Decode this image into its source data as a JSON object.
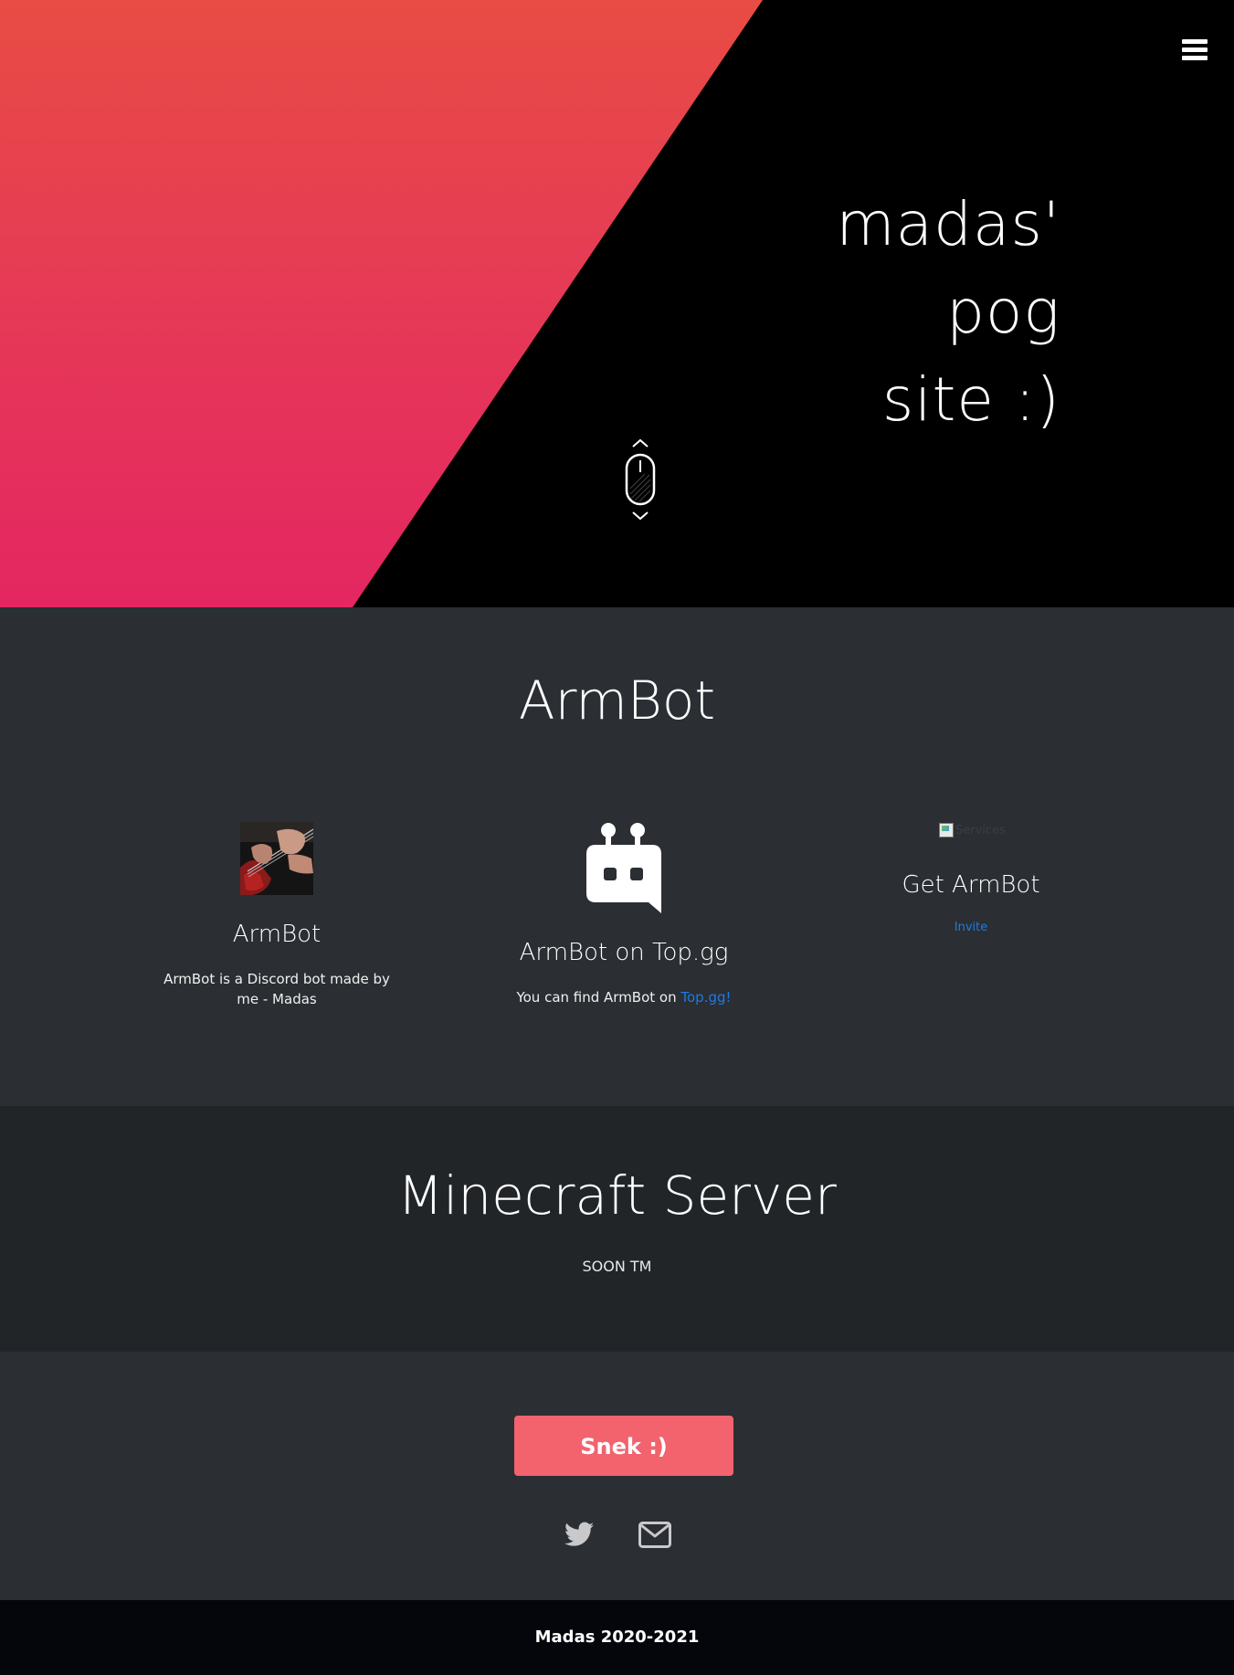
{
  "hero": {
    "title_lines": [
      "madas'",
      "pog",
      "site :)"
    ],
    "menu_icon": "hamburger-menu-icon",
    "scroll_icon": "mouse-scroll-icon",
    "gradient_colors": [
      "#e84c44",
      "#e42661"
    ],
    "background": "#000000"
  },
  "armbot": {
    "title": "ArmBot",
    "cards": [
      {
        "heading": "ArmBot",
        "text": "ArmBot is a Discord bot made by me - Madas",
        "image": "guitar-avatar-image"
      },
      {
        "heading": "ArmBot on Top.gg",
        "text_prefix": "You can find ArmBot on ",
        "link_text": "Top.gg!",
        "image": "topgg-robot-icon"
      },
      {
        "heading": "Get ArmBot",
        "broken_image_alt": "Services",
        "link_text": "Invite"
      }
    ]
  },
  "minecraft": {
    "title": "Minecraft Server",
    "subtitle": "SOON TM"
  },
  "cta": {
    "button_label": "Snek :)",
    "button_color": "#f2636e",
    "social": [
      "twitter-icon",
      "mail-icon"
    ]
  },
  "footer": {
    "text": "Madas 2020-2021"
  }
}
